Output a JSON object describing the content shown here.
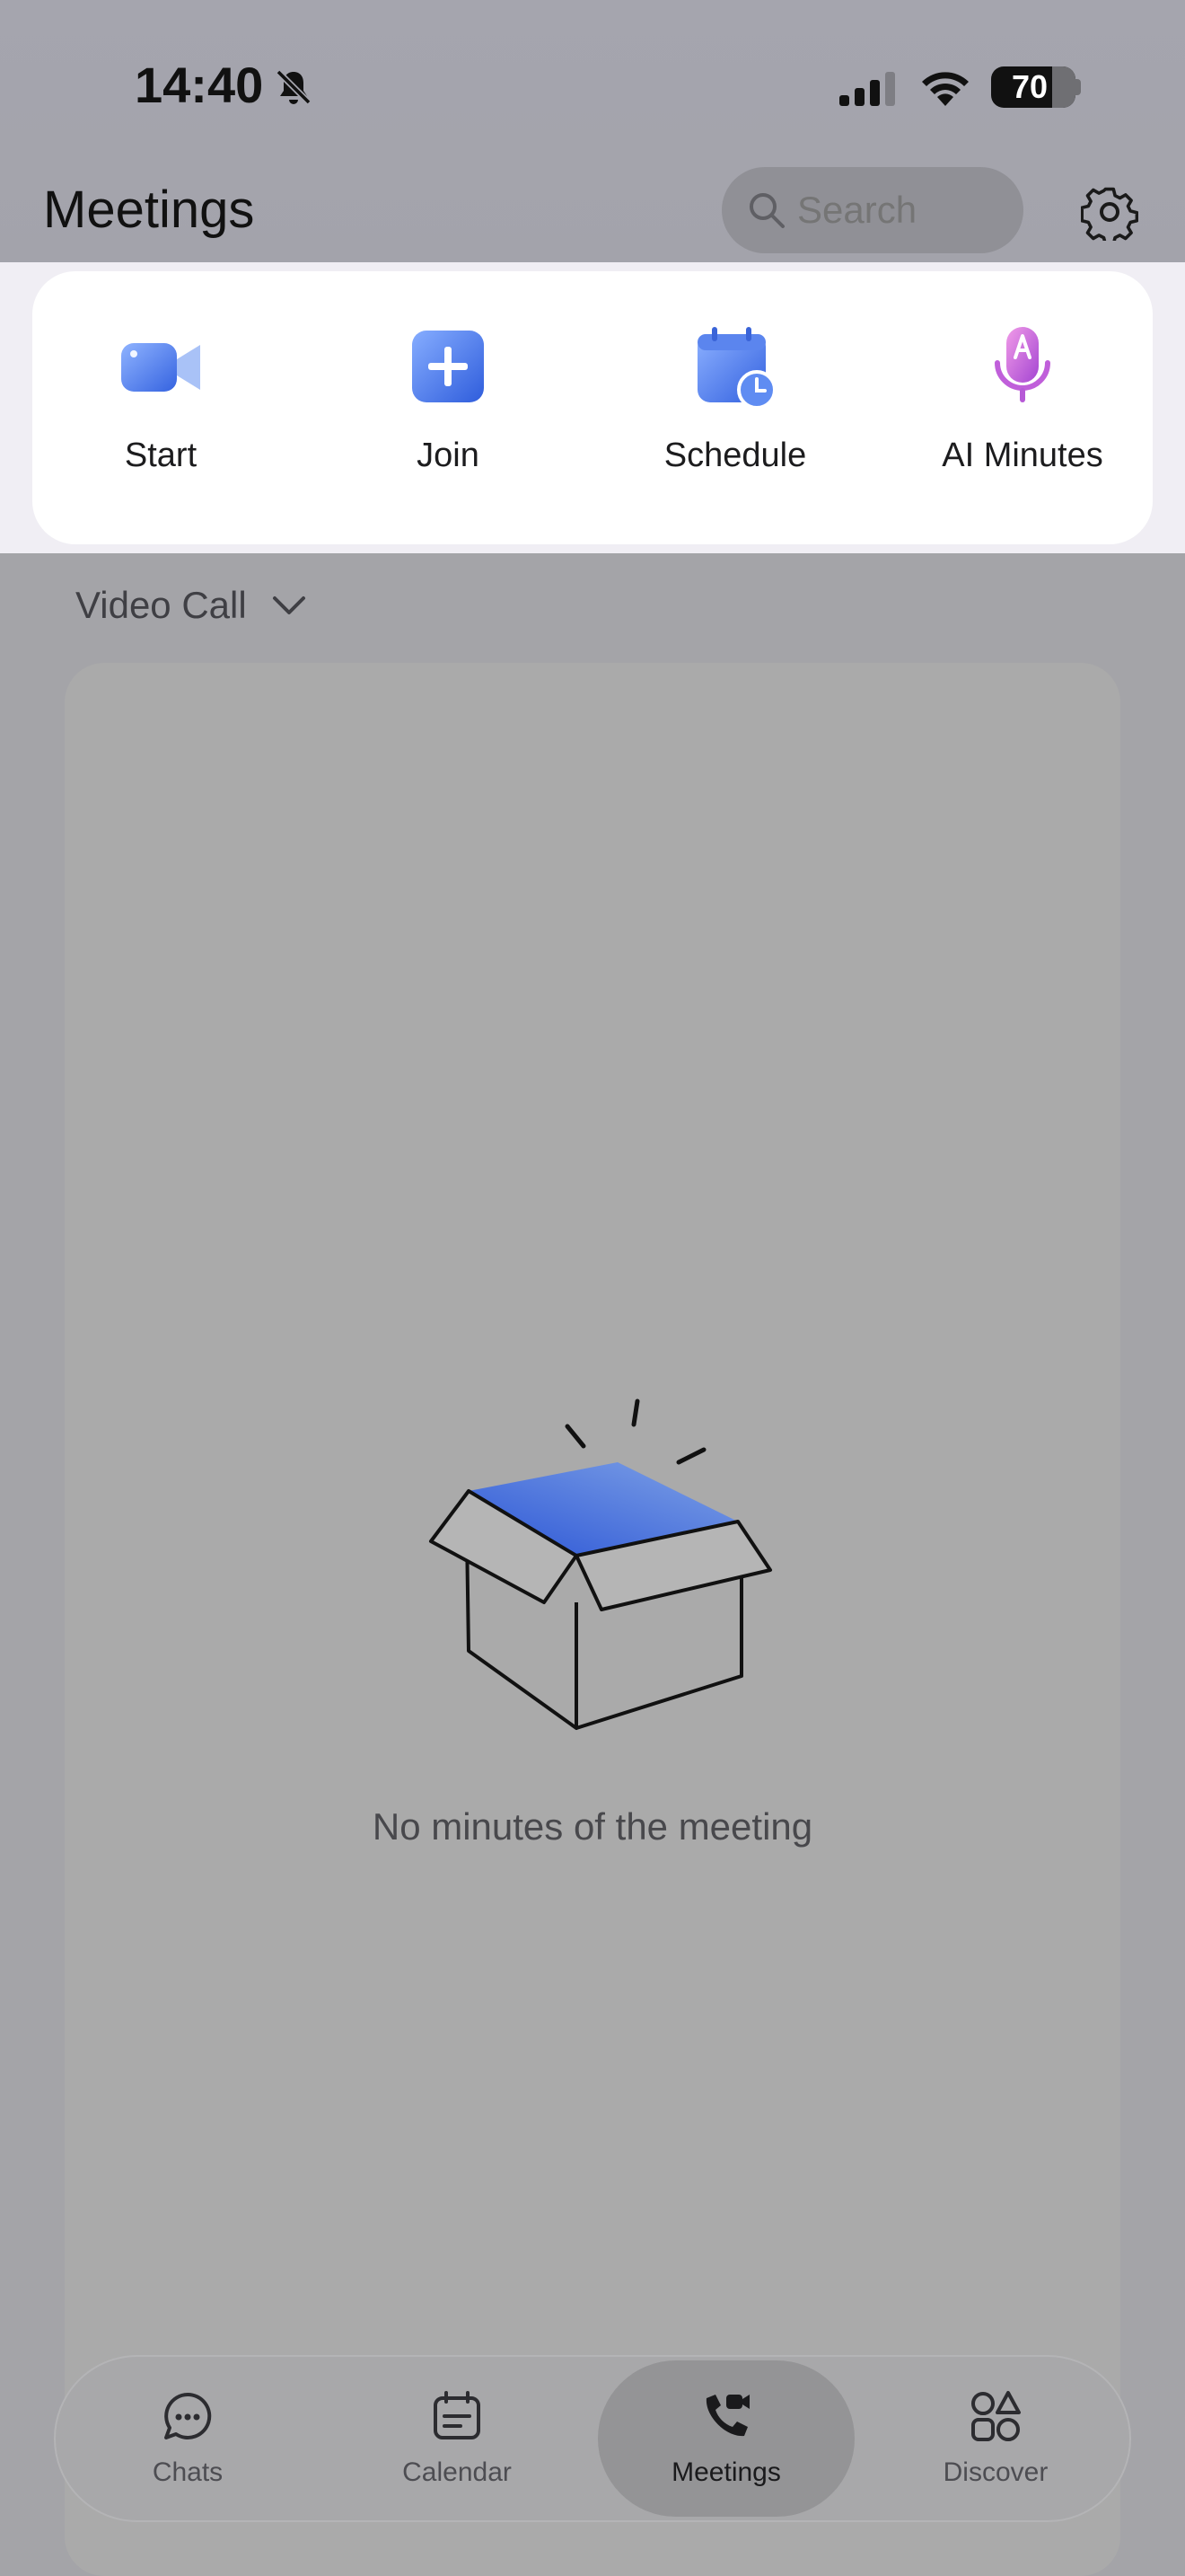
{
  "status_bar": {
    "time": "14:40",
    "battery": "70",
    "icons": [
      "bell-off-icon",
      "signal-icon",
      "wifi-icon",
      "battery-icon"
    ]
  },
  "header": {
    "title": "Meetings",
    "search_placeholder": "Search",
    "settings_icon": "gear-icon"
  },
  "actions": [
    {
      "label": "Start",
      "icon": "video-camera-icon",
      "color": "#3b6fe8"
    },
    {
      "label": "Join",
      "icon": "plus-icon",
      "color": "#3b6fe8"
    },
    {
      "label": "Schedule",
      "icon": "calendar-clock-icon",
      "color": "#3b6fe8"
    },
    {
      "label": "AI Minutes",
      "icon": "microphone-ai-icon",
      "color": "#c35bd8"
    }
  ],
  "filter": {
    "label": "Video Call"
  },
  "empty_state": {
    "message": "No minutes of the meeting",
    "illustration": "open-box-illustration"
  },
  "tabs": [
    {
      "label": "Chats",
      "icon": "chat-bubble-icon",
      "active": false
    },
    {
      "label": "Calendar",
      "icon": "calendar-icon",
      "active": false
    },
    {
      "label": "Meetings",
      "icon": "phone-video-icon",
      "active": true
    },
    {
      "label": "Discover",
      "icon": "shapes-icon",
      "active": false
    }
  ]
}
